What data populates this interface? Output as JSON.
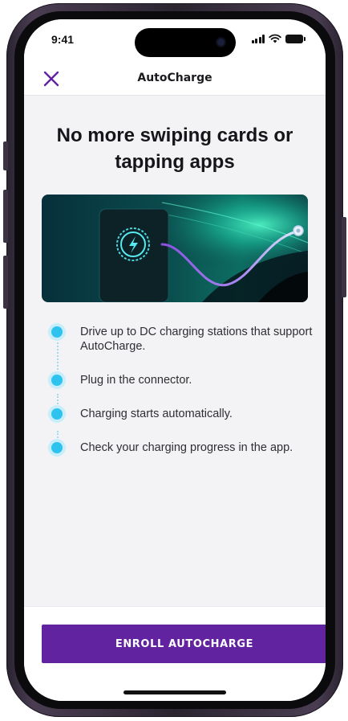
{
  "status_bar": {
    "time": "9:41",
    "icons": [
      "signal-icon",
      "wifi-icon",
      "battery-icon"
    ]
  },
  "nav": {
    "title": "AutoCharge",
    "close_icon": "close-icon"
  },
  "content": {
    "headline": "No more swiping cards or tapping apps",
    "hero_icon": "charging-bolt-icon",
    "steps": [
      {
        "text": "Drive up to DC charging stations that support AutoCharge."
      },
      {
        "text": "Plug in the connector."
      },
      {
        "text": "Charging starts automatically."
      },
      {
        "text": "Check your charging progress in the app."
      }
    ]
  },
  "footer": {
    "enroll_label": "ENROLL AUTOCHARGE"
  },
  "colors": {
    "accent_purple": "#6223a1",
    "step_dot": "#2ec3ee",
    "screen_bg": "#f3f3f5"
  }
}
